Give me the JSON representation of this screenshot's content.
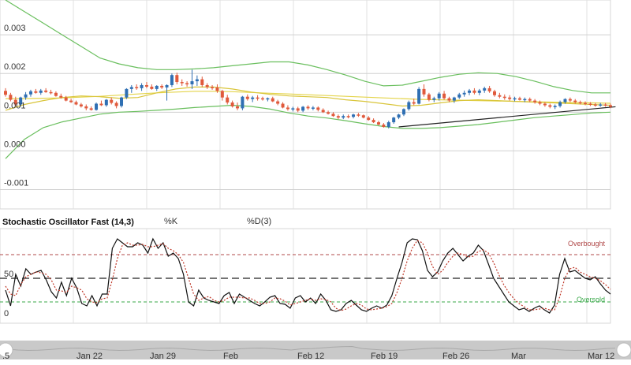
{
  "chart_data": [
    {
      "type": "candlestick",
      "y_ticks": [
        "0.003",
        "0.002",
        "0.001",
        "0.000",
        "-0.001"
      ],
      "ylim": [
        -0.0015,
        0.0039
      ],
      "x_labels": [
        ".5",
        "Jan 22",
        "Jan 29",
        "Feb",
        "Feb 12",
        "Feb 19",
        "Feb 26",
        "Mar",
        "Mar 12"
      ],
      "grid": true,
      "colors": {
        "up": "#2f6fb3",
        "down": "#e05a3c",
        "bollinger": "#6abf5e",
        "ma": "#e4d44a",
        "trendline": "#222222"
      },
      "candles": [
        [
          0.00155,
          0.00162,
          0.0014,
          0.00145
        ],
        [
          0.00145,
          0.0015,
          0.00128,
          0.00132
        ],
        [
          0.00132,
          0.0014,
          0.00115,
          0.0012
        ],
        [
          0.0012,
          0.0014,
          0.00115,
          0.00138
        ],
        [
          0.00138,
          0.00152,
          0.00132,
          0.00146
        ],
        [
          0.00146,
          0.00158,
          0.0014,
          0.00154
        ],
        [
          0.00154,
          0.0016,
          0.00148,
          0.0015
        ],
        [
          0.0015,
          0.0016,
          0.00145,
          0.00156
        ],
        [
          0.00156,
          0.00162,
          0.0015,
          0.00152
        ],
        [
          0.00152,
          0.00158,
          0.00146,
          0.0015
        ],
        [
          0.0015,
          0.00154,
          0.0014,
          0.00142
        ],
        [
          0.00142,
          0.00148,
          0.00135,
          0.00138
        ],
        [
          0.00138,
          0.00142,
          0.00128,
          0.0013
        ],
        [
          0.0013,
          0.00135,
          0.00124,
          0.00126
        ],
        [
          0.00126,
          0.0013,
          0.00118,
          0.0012
        ],
        [
          0.0012,
          0.00124,
          0.00112,
          0.00115
        ],
        [
          0.00115,
          0.0012,
          0.00105,
          0.0011
        ],
        [
          0.0011,
          0.00115,
          0.00104,
          0.00106
        ],
        [
          0.00106,
          0.00125,
          0.00104,
          0.00122
        ],
        [
          0.00122,
          0.0013,
          0.00116,
          0.00118
        ],
        [
          0.00118,
          0.00134,
          0.00114,
          0.00132
        ],
        [
          0.00132,
          0.00138,
          0.0012,
          0.00124
        ],
        [
          0.00124,
          0.00128,
          0.0011,
          0.00116
        ],
        [
          0.00116,
          0.0014,
          0.00112,
          0.00138
        ],
        [
          0.00138,
          0.00162,
          0.00134,
          0.0016
        ],
        [
          0.0016,
          0.0017,
          0.0015,
          0.00165
        ],
        [
          0.00165,
          0.00172,
          0.00158,
          0.00162
        ],
        [
          0.00162,
          0.00175,
          0.00155,
          0.0017
        ],
        [
          0.0017,
          0.00178,
          0.00162,
          0.00166
        ],
        [
          0.00166,
          0.00172,
          0.00158,
          0.0016
        ],
        [
          0.0016,
          0.0017,
          0.00155,
          0.00168
        ],
        [
          0.00168,
          0.00172,
          0.0016,
          0.00164
        ],
        [
          0.00164,
          0.00172,
          0.0013,
          0.0017
        ],
        [
          0.0017,
          0.002,
          0.00165,
          0.00196
        ],
        [
          0.00196,
          0.00202,
          0.00172,
          0.00178
        ],
        [
          0.00178,
          0.00185,
          0.00168,
          0.00175
        ],
        [
          0.00175,
          0.0018,
          0.00166,
          0.00172
        ],
        [
          0.00172,
          0.0021,
          0.0016,
          0.0018
        ],
        [
          0.0018,
          0.00195,
          0.00168,
          0.00185
        ],
        [
          0.00185,
          0.00192,
          0.00165,
          0.0017
        ],
        [
          0.0017,
          0.00175,
          0.0016,
          0.00165
        ],
        [
          0.00165,
          0.0017,
          0.00158,
          0.00164
        ],
        [
          0.00164,
          0.00172,
          0.0015,
          0.00155
        ],
        [
          0.00155,
          0.00158,
          0.0013,
          0.00138
        ],
        [
          0.00138,
          0.00145,
          0.0012,
          0.00125
        ],
        [
          0.00125,
          0.0013,
          0.00112,
          0.00115
        ],
        [
          0.00115,
          0.00125,
          0.00105,
          0.0011
        ],
        [
          0.0011,
          0.00142,
          0.00105,
          0.0014
        ],
        [
          0.0014,
          0.00146,
          0.0013,
          0.00134
        ],
        [
          0.00134,
          0.00142,
          0.00126,
          0.00138
        ],
        [
          0.00138,
          0.00144,
          0.0013,
          0.00136
        ],
        [
          0.00136,
          0.0014,
          0.0013,
          0.00133
        ],
        [
          0.00133,
          0.00138,
          0.00128,
          0.00136
        ],
        [
          0.00136,
          0.0014,
          0.00126,
          0.00128
        ],
        [
          0.00128,
          0.00132,
          0.00118,
          0.00122
        ],
        [
          0.00122,
          0.00126,
          0.0011,
          0.00112
        ],
        [
          0.00112,
          0.00118,
          0.00104,
          0.00108
        ],
        [
          0.00108,
          0.00114,
          0.00102,
          0.0011
        ],
        [
          0.0011,
          0.00114,
          0.001,
          0.00104
        ],
        [
          0.00104,
          0.00116,
          0.001,
          0.00114
        ],
        [
          0.00114,
          0.00118,
          0.00106,
          0.0011
        ],
        [
          0.0011,
          0.00116,
          0.00105,
          0.00112
        ],
        [
          0.00112,
          0.00115,
          0.00102,
          0.00106
        ],
        [
          0.00106,
          0.0011,
          0.00098,
          0.001
        ],
        [
          0.001,
          0.00104,
          0.00094,
          0.00096
        ],
        [
          0.00096,
          0.001,
          0.00088,
          0.0009
        ],
        [
          0.0009,
          0.00094,
          0.00082,
          0.00086
        ],
        [
          0.00086,
          0.00094,
          0.00082,
          0.0009
        ],
        [
          0.0009,
          0.00094,
          0.00084,
          0.00088
        ],
        [
          0.00088,
          0.00096,
          0.00084,
          0.00094
        ],
        [
          0.00094,
          0.00098,
          0.00088,
          0.00092
        ],
        [
          0.00092,
          0.00094,
          0.00084,
          0.00086
        ],
        [
          0.00086,
          0.0009,
          0.00078,
          0.0008
        ],
        [
          0.0008,
          0.00084,
          0.00072,
          0.00074
        ],
        [
          0.00074,
          0.00078,
          0.00066,
          0.00068
        ],
        [
          0.00068,
          0.00072,
          0.0006,
          0.00062
        ],
        [
          0.00062,
          0.00078,
          0.00058,
          0.00074
        ],
        [
          0.00074,
          0.00088,
          0.0007,
          0.00086
        ],
        [
          0.00086,
          0.00096,
          0.00082,
          0.00094
        ],
        [
          0.00094,
          0.0011,
          0.0009,
          0.00108
        ],
        [
          0.00108,
          0.0013,
          0.00104,
          0.00126
        ],
        [
          0.00126,
          0.00135,
          0.00118,
          0.00122
        ],
        [
          0.00122,
          0.00165,
          0.0012,
          0.0016
        ],
        [
          0.0016,
          0.00172,
          0.0014,
          0.00146
        ],
        [
          0.00146,
          0.0015,
          0.00128,
          0.00132
        ],
        [
          0.00132,
          0.0014,
          0.00126,
          0.00136
        ],
        [
          0.00136,
          0.00152,
          0.0013,
          0.00148
        ],
        [
          0.00148,
          0.00155,
          0.00132,
          0.00136
        ],
        [
          0.00136,
          0.0014,
          0.00126,
          0.0013
        ],
        [
          0.0013,
          0.0014,
          0.00124,
          0.00138
        ],
        [
          0.00138,
          0.0015,
          0.00134,
          0.00146
        ],
        [
          0.00146,
          0.00156,
          0.0014,
          0.0015
        ],
        [
          0.0015,
          0.0016,
          0.00144,
          0.00156
        ],
        [
          0.00156,
          0.00162,
          0.00146,
          0.0015
        ],
        [
          0.0015,
          0.0016,
          0.00144,
          0.00156
        ],
        [
          0.00156,
          0.00166,
          0.0015,
          0.00162
        ],
        [
          0.00162,
          0.00168,
          0.0015,
          0.00154
        ],
        [
          0.00154,
          0.00158,
          0.0014,
          0.00144
        ],
        [
          0.00144,
          0.0015,
          0.00136,
          0.0014
        ],
        [
          0.0014,
          0.00146,
          0.00132,
          0.00138
        ],
        [
          0.00138,
          0.00144,
          0.0013,
          0.00134
        ],
        [
          0.00134,
          0.0014,
          0.00128,
          0.00136
        ],
        [
          0.00136,
          0.0014,
          0.0013,
          0.00132
        ],
        [
          0.00132,
          0.00138,
          0.00126,
          0.00134
        ],
        [
          0.00134,
          0.00138,
          0.00126,
          0.0013
        ],
        [
          0.0013,
          0.00134,
          0.00122,
          0.00126
        ],
        [
          0.00126,
          0.0013,
          0.00118,
          0.00122
        ],
        [
          0.00122,
          0.00126,
          0.00114,
          0.00118
        ],
        [
          0.00118,
          0.00122,
          0.0011,
          0.00114
        ],
        [
          0.00114,
          0.0012,
          0.00108,
          0.00116
        ],
        [
          0.00116,
          0.0013,
          0.00112,
          0.00126
        ],
        [
          0.00126,
          0.00136,
          0.00122,
          0.00134
        ],
        [
          0.00134,
          0.00138,
          0.00126,
          0.0013
        ],
        [
          0.0013,
          0.00134,
          0.00122,
          0.00126
        ],
        [
          0.00126,
          0.0013,
          0.0012,
          0.00124
        ],
        [
          0.00124,
          0.00128,
          0.00118,
          0.00122
        ],
        [
          0.00122,
          0.00126,
          0.00116,
          0.0012
        ],
        [
          0.0012,
          0.00124,
          0.00114,
          0.00118
        ],
        [
          0.00118,
          0.00124,
          0.00114,
          0.0012
        ],
        [
          0.0012,
          0.00124,
          0.00114,
          0.00118
        ],
        [
          0.00118,
          0.00122,
          0.0011,
          0.00114
        ]
      ],
      "bollinger_upper": [
        0.0039,
        0.0036,
        0.0033,
        0.003,
        0.0027,
        0.0024,
        0.00225,
        0.00215,
        0.0021,
        0.0021,
        0.00212,
        0.00215,
        0.0022,
        0.00225,
        0.0023,
        0.0023,
        0.00222,
        0.0021,
        0.00196,
        0.0018,
        0.00168,
        0.0017,
        0.0018,
        0.0019,
        0.00198,
        0.00202,
        0.002,
        0.00192,
        0.0018,
        0.00166,
        0.00156,
        0.0015,
        0.0015
      ],
      "bollinger_lower": [
        -0.0002,
        0.0003,
        0.0006,
        0.00075,
        0.00085,
        0.00095,
        0.001,
        0.00102,
        0.00105,
        0.00108,
        0.00112,
        0.00115,
        0.00118,
        0.00115,
        0.00108,
        0.00098,
        0.0009,
        0.00085,
        0.00078,
        0.0007,
        0.00063,
        0.00058,
        0.00058,
        0.0006,
        0.00064,
        0.00068,
        0.00074,
        0.0008,
        0.00086,
        0.0009,
        0.00094,
        0.00098,
        0.001
      ],
      "ma_fast": [
        0.00105,
        0.0012,
        0.0013,
        0.00138,
        0.00142,
        0.0014,
        0.00136,
        0.00138,
        0.0015,
        0.0016,
        0.00165,
        0.00165,
        0.0016,
        0.00152,
        0.00146,
        0.00142,
        0.0014,
        0.00138,
        0.00132,
        0.00128,
        0.00122,
        0.00116,
        0.00118,
        0.00124,
        0.0013,
        0.00132,
        0.0013,
        0.00128,
        0.00126,
        0.00124,
        0.00122,
        0.0012,
        0.00118
      ],
      "ma_slow": [
        0.00135,
        0.00135,
        0.00136,
        0.00137,
        0.00139,
        0.00141,
        0.00144,
        0.00147,
        0.0015,
        0.00152,
        0.00154,
        0.00154,
        0.00153,
        0.00151,
        0.00149,
        0.00147,
        0.00145,
        0.00143,
        0.00141,
        0.00139,
        0.00137,
        0.00135,
        0.00133,
        0.00132,
        0.00131,
        0.0013,
        0.00129,
        0.00128,
        0.00127,
        0.00126,
        0.00125,
        0.00124,
        0.00123
      ],
      "trendline": [
        [
          78,
          0.00062
        ],
        [
          121,
          0.00114
        ]
      ]
    },
    {
      "type": "line",
      "title": "Stochastic Oscillator Fast (14,3)",
      "legend": [
        "%K",
        "%D(3)"
      ],
      "y_ticks": [
        "50",
        "0"
      ],
      "ylim": [
        -7,
        113
      ],
      "annotations": [
        "Overbought",
        "Oversold"
      ],
      "overbought": 80,
      "oversold": 20,
      "midline": 50,
      "series": [
        {
          "name": "%K",
          "values": [
            35,
            15,
            55,
            40,
            62,
            55,
            58,
            60,
            48,
            33,
            25,
            45,
            28,
            50,
            38,
            18,
            15,
            28,
            15,
            30,
            30,
            88,
            100,
            95,
            90,
            90,
            95,
            92,
            82,
            100,
            88,
            95,
            78,
            82,
            75,
            55,
            20,
            15,
            35,
            25,
            22,
            20,
            18,
            28,
            32,
            18,
            30,
            26,
            22,
            18,
            15,
            20,
            26,
            28,
            18,
            17,
            12,
            25,
            28,
            20,
            25,
            18,
            30,
            22,
            10,
            8,
            10,
            18,
            22,
            16,
            10,
            8,
            12,
            15,
            12,
            16,
            28,
            50,
            70,
            95,
            100,
            99,
            85,
            60,
            52,
            58,
            72,
            82,
            88,
            80,
            72,
            78,
            82,
            92,
            85,
            68,
            50,
            40,
            30,
            20,
            15,
            10,
            12,
            8,
            12,
            15,
            10,
            6,
            16,
            55,
            75,
            58,
            60,
            55,
            50,
            48,
            52,
            43,
            35,
            30
          ]
        },
        {
          "name": "%D(3)",
          "values": [
            40,
            30,
            28,
            42,
            52,
            55,
            58,
            57,
            55,
            48,
            35,
            34,
            32,
            40,
            38,
            35,
            24,
            20,
            19,
            24,
            25,
            48,
            75,
            92,
            95,
            92,
            92,
            93,
            90,
            90,
            92,
            94,
            88,
            85,
            80,
            70,
            50,
            30,
            22,
            25,
            27,
            22,
            20,
            22,
            26,
            26,
            26,
            25,
            25,
            22,
            18,
            18,
            20,
            25,
            24,
            21,
            16,
            18,
            20,
            22,
            24,
            22,
            24,
            23,
            20,
            12,
            9,
            11,
            15,
            18,
            16,
            11,
            10,
            11,
            12,
            14,
            18,
            32,
            50,
            72,
            88,
            98,
            95,
            82,
            65,
            55,
            60,
            70,
            78,
            82,
            80,
            77,
            78,
            84,
            86,
            82,
            70,
            55,
            42,
            32,
            24,
            18,
            14,
            10,
            10,
            11,
            12,
            10,
            10,
            26,
            50,
            62,
            64,
            58,
            55,
            52,
            50,
            47,
            42,
            36
          ]
        }
      ]
    }
  ]
}
